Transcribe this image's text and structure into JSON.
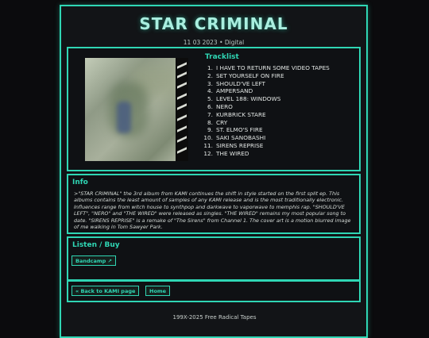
{
  "album": {
    "title": "STAR CRIMINAL",
    "subtitle": "11 03 2023 • Digital"
  },
  "tracklist": {
    "heading": "Tracklist",
    "tracks": [
      {
        "num": "1.",
        "name": "I HAVE TO RETURN SOME VIDEO TAPES"
      },
      {
        "num": "2.",
        "name": "SET YOURSELF ON FIRE"
      },
      {
        "num": "3.",
        "name": "SHOULD'VE LEFT"
      },
      {
        "num": "4.",
        "name": "AMPERSAND"
      },
      {
        "num": "5.",
        "name": "LEVEL 188: WINDOWS"
      },
      {
        "num": "6.",
        "name": "NERO"
      },
      {
        "num": "7.",
        "name": "KURBRICK STARE"
      },
      {
        "num": "8.",
        "name": "CRY"
      },
      {
        "num": "9.",
        "name": "ST. ELMO'S FIRE"
      },
      {
        "num": "10.",
        "name": "SAKI SANOBASHI"
      },
      {
        "num": "11.",
        "name": "SIRENS REPRISE"
      },
      {
        "num": "12.",
        "name": "THE WIRED"
      }
    ]
  },
  "info": {
    "heading": "Info",
    "text": ">\"STAR CRIMINAL\" the 3rd album from KAMI continues the shift in style started on the first split ep. This albums contains the least amount of samples of any KAMI release and is the most traditionally electronic. Influences range from witch house to synthpop and darkwave to vaporwave to memphis rap. \"SHOULD'VE LEFT\", \"NERO\" and \"THE WIRED\" were released as singles. \"THE WIRED\" remains my most popular song to date. \"SIRENS REPRISE\" is a remake of \"The Sirens\" from Channel 1. The cover art is a motion blurred image of me walking in Tom Sawyer Park."
  },
  "listen": {
    "heading": "Listen / Buy",
    "bandcamp_label": "Bandcamp ↗"
  },
  "nav": {
    "back_label": "« Back to KAMI page",
    "home_label": "Home"
  },
  "footer": {
    "text": "199X-2025 Free Radical Tapes"
  },
  "colors": {
    "accent": "#2fd6b4",
    "background": "#0b0b0d",
    "panel": "#0f1114"
  }
}
